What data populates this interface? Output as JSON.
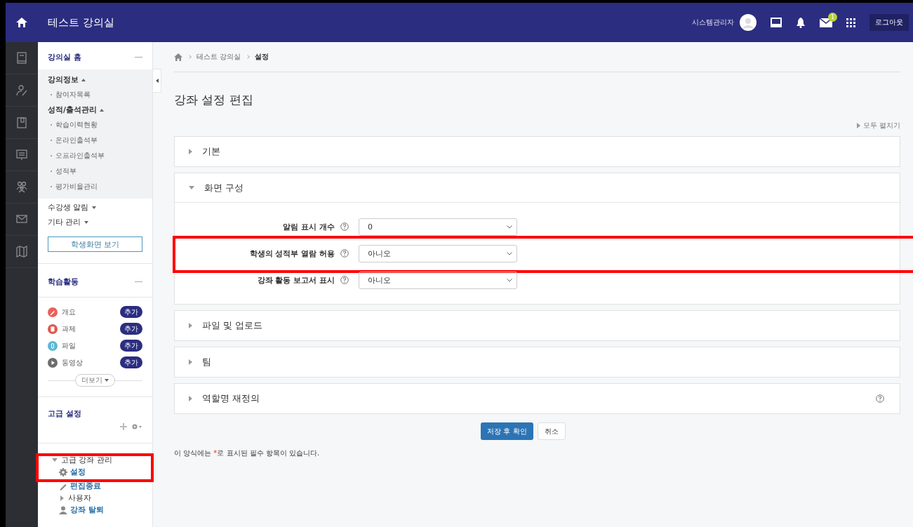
{
  "topbar": {
    "title": "테스트 강의실",
    "user_name": "시스템관리자",
    "message_badge": "1",
    "logout": "로그아웃"
  },
  "sidebar": {
    "home_block": {
      "title": "강의실 홈",
      "groups": [
        {
          "label": "강의정보",
          "expanded": true,
          "children": [
            "참여자목록"
          ]
        },
        {
          "label": "성적/출석관리",
          "expanded": true,
          "children": [
            "학습이력현황",
            "온라인출석부",
            "오프라인출석부",
            "성적부",
            "평가비율관리"
          ]
        },
        {
          "label": "수강생 알림",
          "expanded": false
        },
        {
          "label": "기타 관리",
          "expanded": false
        }
      ],
      "button": "학생화면 보기"
    },
    "activities_block": {
      "title": "학습활동",
      "items": [
        {
          "label": "개요",
          "color": "#e8625a",
          "kind": "pencil",
          "button": "추가"
        },
        {
          "label": "과제",
          "color": "#e0574f",
          "kind": "document",
          "button": "추가"
        },
        {
          "label": "파일",
          "color": "#5bb8d4",
          "kind": "clip",
          "button": "추가"
        },
        {
          "label": "동영상",
          "color": "#6d6d6d",
          "kind": "play",
          "button": "추가"
        }
      ],
      "more": "더보기"
    },
    "advanced_block": {
      "title": "고급 설정"
    },
    "tree": {
      "label": "고급 강좌 관리",
      "expanded": true,
      "highlighted": true,
      "children": [
        {
          "label": "설정",
          "kind": "gear"
        },
        {
          "label": "편집종료",
          "kind": "pencil"
        },
        {
          "label": "사용자",
          "kind": "branch"
        },
        {
          "label": "강좌 탈퇴",
          "kind": "person"
        }
      ]
    }
  },
  "breadcrumb": [
    "테스트 강의실",
    "설정"
  ],
  "page_title": "강좌 설정 편집",
  "expand_all": "모두 펼치기",
  "sections": [
    {
      "title": "기본",
      "expanded": false,
      "help": false
    },
    {
      "title": "화면 구성",
      "expanded": true,
      "help": false,
      "fields": [
        {
          "label": "알림 표시 개수",
          "value": "0",
          "highlighted": false
        },
        {
          "label": "학생의 성적부 열람 허용",
          "value": "아니오",
          "highlighted": true
        },
        {
          "label": "강좌 활동 보고서 표시",
          "value": "아니오",
          "highlighted": false
        }
      ]
    },
    {
      "title": "파일 및 업로드",
      "expanded": false,
      "help": false
    },
    {
      "title": "팀",
      "expanded": false,
      "help": false
    },
    {
      "title": "역할명 재정의",
      "expanded": false,
      "help": true
    }
  ],
  "buttons": [
    {
      "label": "저장 후 확인",
      "kind": "primary"
    },
    {
      "label": "취소",
      "kind": "secondary"
    }
  ],
  "required_note": {
    "before": "이 양식에는 ",
    "mark": "*",
    "after": "로 표시된 필수 항목이 있습니다."
  }
}
